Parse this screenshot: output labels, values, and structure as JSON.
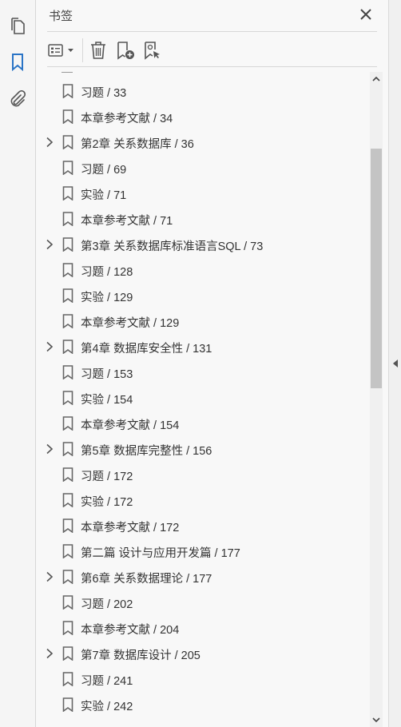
{
  "nav": {
    "pages_icon": "pages-icon",
    "bookmarks_icon": "bookmark-icon",
    "attachments_icon": "paperclip-icon"
  },
  "panel": {
    "title": "书签",
    "close_icon": "close-icon"
  },
  "toolbar": {
    "options_icon": "list-options-icon",
    "delete_icon": "trash-icon",
    "add_icon": "new-bookmark-icon",
    "search_icon": "bookmark-search-icon"
  },
  "bookmarks": [
    {
      "label": "习题 / 33",
      "expandable": false
    },
    {
      "label": "本章参考文献 / 34",
      "expandable": false
    },
    {
      "label": "第2章 关系数据库 / 36",
      "expandable": true
    },
    {
      "label": "习题 / 69",
      "expandable": false
    },
    {
      "label": "实验 / 71",
      "expandable": false
    },
    {
      "label": "本章参考文献 / 71",
      "expandable": false
    },
    {
      "label": "第3章 关系数据库标准语言SQL / 73",
      "expandable": true
    },
    {
      "label": "习题 / 128",
      "expandable": false
    },
    {
      "label": "实验 / 129",
      "expandable": false
    },
    {
      "label": "本章参考文献 / 129",
      "expandable": false
    },
    {
      "label": "第4章 数据库安全性 / 131",
      "expandable": true
    },
    {
      "label": "习题 / 153",
      "expandable": false
    },
    {
      "label": "实验 / 154",
      "expandable": false
    },
    {
      "label": "本章参考文献 / 154",
      "expandable": false
    },
    {
      "label": "第5章 数据库完整性 / 156",
      "expandable": true
    },
    {
      "label": "习题 / 172",
      "expandable": false
    },
    {
      "label": "实验 / 172",
      "expandable": false
    },
    {
      "label": "本章参考文献 / 172",
      "expandable": false
    },
    {
      "label": "第二篇 设计与应用开发篇 / 177",
      "expandable": false
    },
    {
      "label": "第6章 关系数据理论 / 177",
      "expandable": true
    },
    {
      "label": "习题 / 202",
      "expandable": false
    },
    {
      "label": "本章参考文献 / 204",
      "expandable": false
    },
    {
      "label": "第7章 数据库设计 / 205",
      "expandable": true
    },
    {
      "label": "习题 / 241",
      "expandable": false
    },
    {
      "label": "实验 / 242",
      "expandable": false
    }
  ],
  "colors": {
    "accent": "#2a74c6",
    "icon": "#555555",
    "text": "#333333"
  }
}
